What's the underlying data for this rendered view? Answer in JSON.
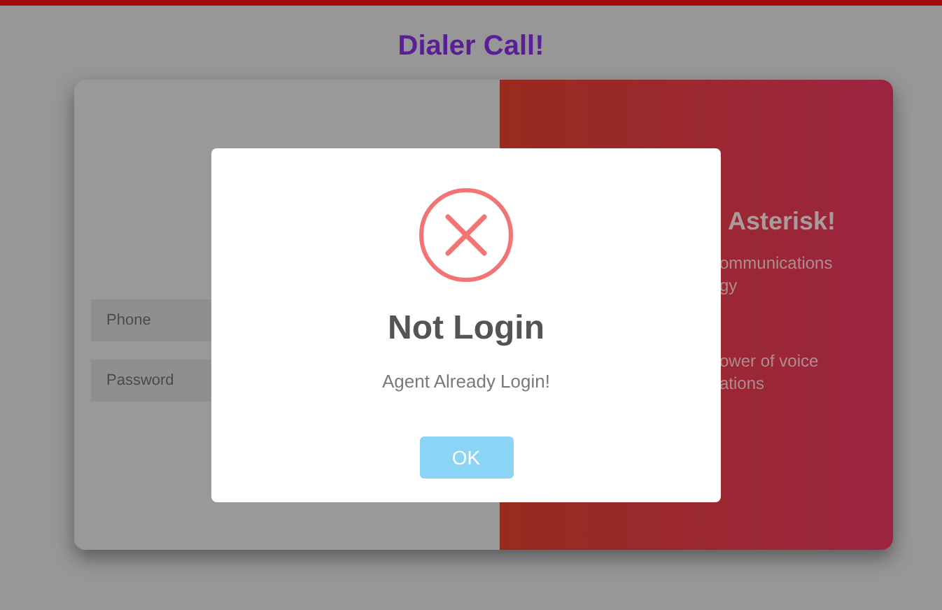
{
  "title": "Dialer Call!",
  "login_form": {
    "fields": [
      {
        "placeholder": "Phone"
      },
      {
        "placeholder": "Password"
      }
    ]
  },
  "info_panel": {
    "heading": "Asterisk!",
    "paragraphs": [
      [
        "ommunications",
        "gy"
      ],
      [
        "ower of voice",
        "ations"
      ]
    ]
  },
  "dialog": {
    "kind": "error",
    "title": "Not Login",
    "message": "Agent Already Login!",
    "buttons": [
      {
        "label": "OK"
      }
    ]
  }
}
